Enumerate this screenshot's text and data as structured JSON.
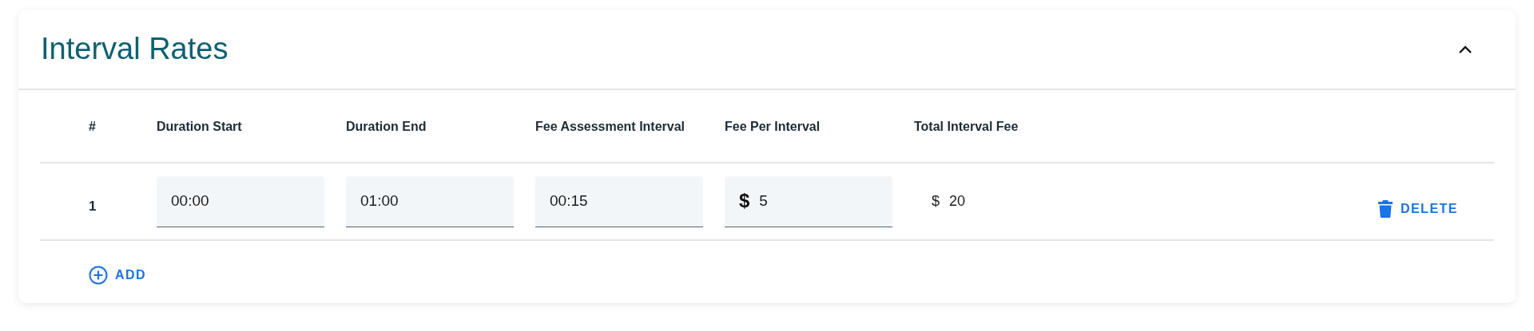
{
  "section": {
    "title": "Interval Rates",
    "expanded": true
  },
  "table": {
    "columns": [
      "#",
      "Duration Start",
      "Duration End",
      "Fee Assessment Interval",
      "Fee Per Interval",
      "Total Interval Fee"
    ],
    "rows": [
      {
        "index": "1",
        "duration_start": "00:00",
        "duration_end": "01:00",
        "fee_assessment_interval": "00:15",
        "fee_per_interval": {
          "prefix": "$",
          "value": "5"
        },
        "total_interval_fee": {
          "prefix": "$",
          "value": "20"
        },
        "action": "DELETE"
      }
    ]
  },
  "add_button": "ADD"
}
